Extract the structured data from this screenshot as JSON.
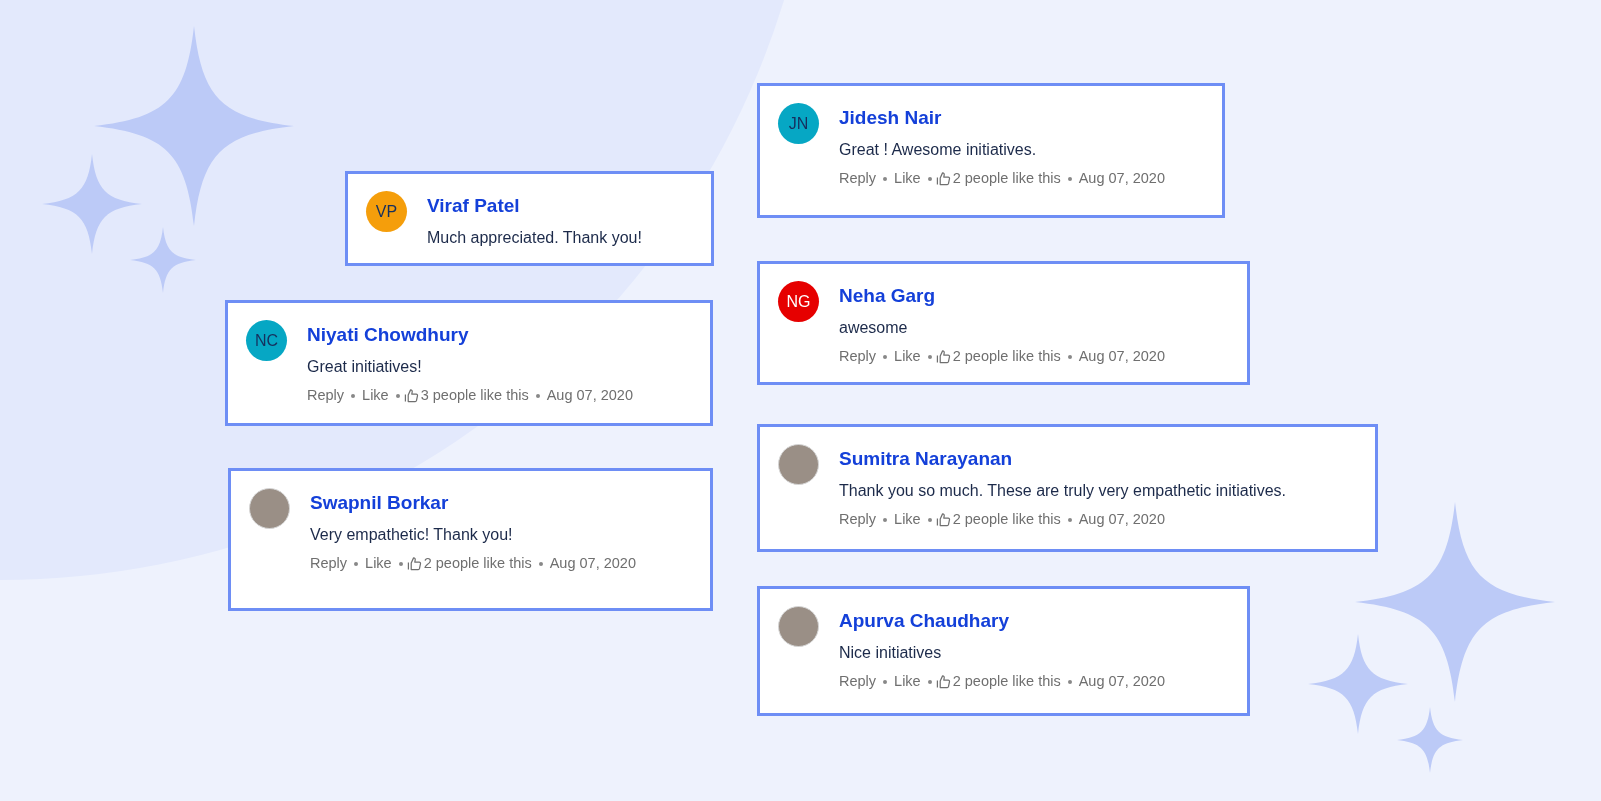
{
  "comments": [
    {
      "name": "Viraf Patel",
      "avatar": {
        "kind": "initials",
        "initials": "VP",
        "color": "#f59e0b"
      },
      "text": "Much appreciated. Thank you!"
    },
    {
      "name": "Niyati Chowdhury",
      "avatar": {
        "kind": "initials",
        "initials": "NC",
        "color": "#06a7c4"
      },
      "text": "Great initiatives!",
      "actions": {
        "reply": "Reply",
        "like": "Like",
        "likes": "3 people like this",
        "date": "Aug 07, 2020"
      }
    },
    {
      "name": "Swapnil Borkar",
      "avatar": {
        "kind": "photo"
      },
      "text": "Very empathetic! Thank you!",
      "actions": {
        "reply": "Reply",
        "like": "Like",
        "likes": "2 people like this",
        "date": "Aug 07, 2020"
      }
    },
    {
      "name": "Jidesh Nair",
      "avatar": {
        "kind": "initials",
        "initials": "JN",
        "color": "#06a7c4"
      },
      "text": "Great ! Awesome initiatives.",
      "actions": {
        "reply": "Reply",
        "like": "Like",
        "likes": "2 people like this",
        "date": "Aug 07, 2020"
      }
    },
    {
      "name": "Neha Garg",
      "avatar": {
        "kind": "initials",
        "initials": "NG",
        "color": "#e60000"
      },
      "text": "awesome",
      "actions": {
        "reply": "Reply",
        "like": "Like",
        "likes": "2 people like this",
        "date": "Aug 07, 2020"
      }
    },
    {
      "name": "Sumitra Narayanan",
      "avatar": {
        "kind": "photo"
      },
      "text": "Thank you so much. These are truly very empathetic initiatives.",
      "actions": {
        "reply": "Reply",
        "like": "Like",
        "likes": "2 people like this",
        "date": "Aug 07, 2020"
      }
    },
    {
      "name": "Apurva Chaudhary",
      "avatar": {
        "kind": "photo"
      },
      "text": "Nice initiatives",
      "actions": {
        "reply": "Reply",
        "like": "Like",
        "likes": "2 people like this",
        "date": "Aug 07, 2020"
      }
    }
  ]
}
